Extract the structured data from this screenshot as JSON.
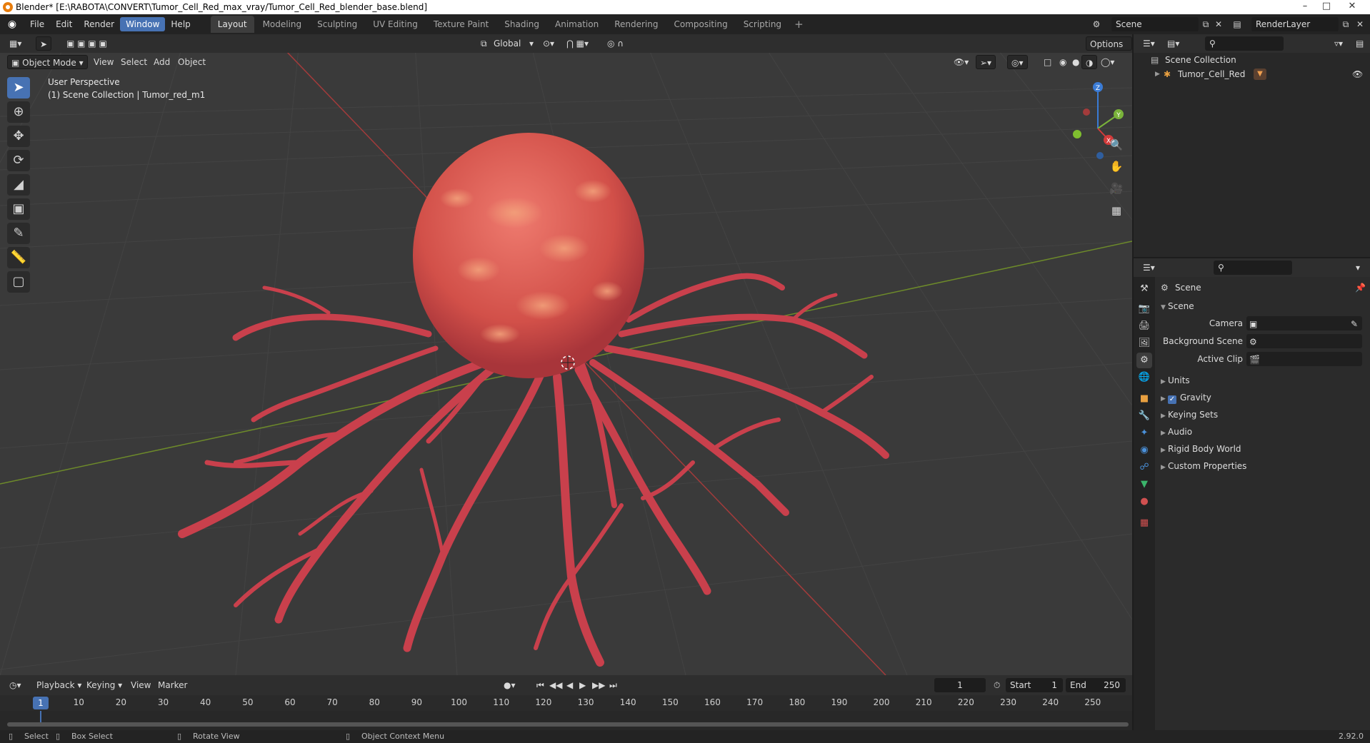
{
  "window": {
    "title": "Blender* [E:\\RABOTA\\CONVERT\\Tumor_Cell_Red_max_vray/Tumor_Cell_Red_blender_base.blend]",
    "minimize": "–",
    "maximize": "□",
    "close": "✕"
  },
  "menubar": {
    "items": [
      "File",
      "Edit",
      "Render",
      "Window",
      "Help"
    ],
    "active_index": 3
  },
  "workspaces": {
    "tabs": [
      "Layout",
      "Modeling",
      "Sculpting",
      "UV Editing",
      "Texture Paint",
      "Shading",
      "Animation",
      "Rendering",
      "Compositing",
      "Scripting"
    ],
    "active_index": 0,
    "add": "+"
  },
  "scene_selector": {
    "value": "Scene"
  },
  "renderlayer_selector": {
    "value": "RenderLayer"
  },
  "viewport": {
    "transform_orientation": "Global",
    "options_label": "Options",
    "mode_label": "Object Mode",
    "menus": [
      "View",
      "Select",
      "Add",
      "Object"
    ],
    "overlay_title": "User Perspective",
    "overlay_subtitle": "(1) Scene Collection | Tumor_red_m1",
    "gizmo_axes": {
      "z": "Z",
      "y": "Y",
      "x": "X"
    }
  },
  "timeline": {
    "menus": [
      "Playback",
      "Keying",
      "View",
      "Marker"
    ],
    "current_frame": "1",
    "start_label": "Start",
    "start_value": "1",
    "end_label": "End",
    "end_value": "250",
    "ticks": [
      "1",
      "10",
      "20",
      "30",
      "40",
      "50",
      "60",
      "70",
      "80",
      "90",
      "100",
      "110",
      "120",
      "130",
      "140",
      "150",
      "160",
      "170",
      "180",
      "190",
      "200",
      "210",
      "220",
      "230",
      "240",
      "250"
    ]
  },
  "statusbar": {
    "select": "Select",
    "box_select": "Box Select",
    "rotate_view": "Rotate View",
    "context_menu": "Object Context Menu",
    "version": "2.92.0"
  },
  "outliner": {
    "collection": "Scene Collection",
    "object": "Tumor_Cell_Red"
  },
  "properties": {
    "context_title": "Scene",
    "section_scene": "Scene",
    "camera_label": "Camera",
    "background_scene_label": "Background Scene",
    "active_clip_label": "Active Clip",
    "panels": [
      "Units",
      "Gravity",
      "Keying Sets",
      "Audio",
      "Rigid Body World",
      "Custom Properties"
    ],
    "gravity_checked": "✓"
  },
  "colors": {
    "accent": "#4772b3",
    "cell": "#d85a5a",
    "axis_x": "#a33b3b",
    "axis_y": "#6d8a2a"
  }
}
